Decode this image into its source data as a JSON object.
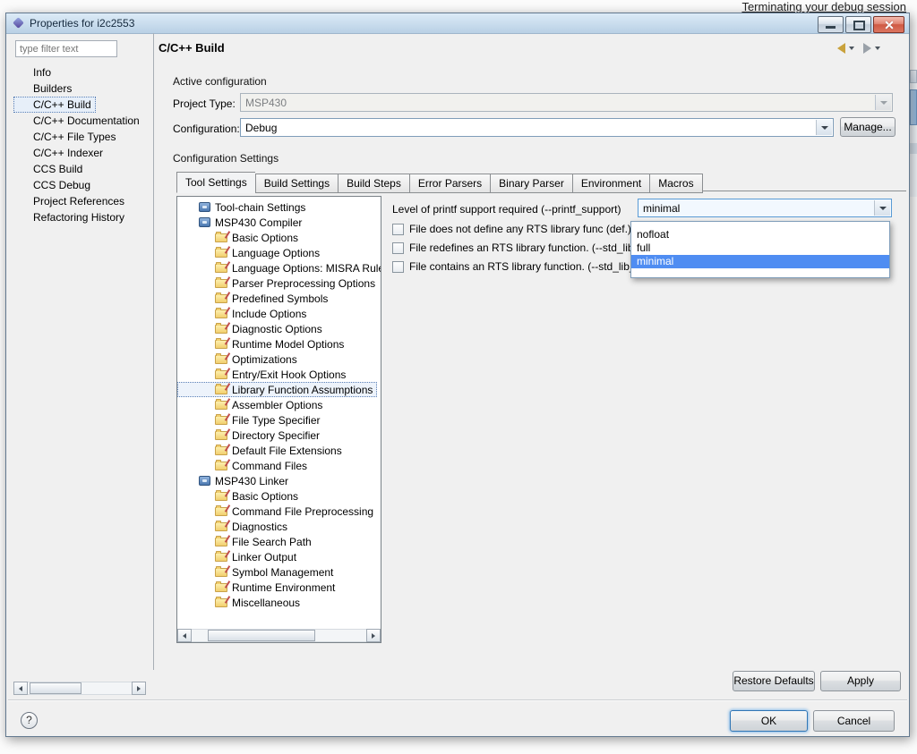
{
  "background": {
    "notification_text": "Terminating your debug session"
  },
  "window": {
    "title": "Properties for i2c2553"
  },
  "filter": {
    "placeholder": "type filter text"
  },
  "sidebar": {
    "items": [
      {
        "label": "Info"
      },
      {
        "label": "Builders"
      },
      {
        "label": "C/C++ Build",
        "selected": true
      },
      {
        "label": "C/C++ Documentation"
      },
      {
        "label": "C/C++ File Types"
      },
      {
        "label": "C/C++ Indexer"
      },
      {
        "label": "CCS Build"
      },
      {
        "label": "CCS Debug"
      },
      {
        "label": "Project References"
      },
      {
        "label": "Refactoring History"
      }
    ]
  },
  "header": {
    "title": "C/C++ Build"
  },
  "active_configuration": {
    "section_label": "Active configuration",
    "project_type_label": "Project Type:",
    "project_type_value": "MSP430",
    "configuration_label": "Configuration:",
    "configuration_value": "Debug",
    "manage_button": "Manage..."
  },
  "configuration_settings": {
    "section_label": "Configuration Settings",
    "tabs": [
      {
        "label": "Tool Settings",
        "active": true
      },
      {
        "label": "Build Settings"
      },
      {
        "label": "Build Steps"
      },
      {
        "label": "Error Parsers"
      },
      {
        "label": "Binary Parser"
      },
      {
        "label": "Environment"
      },
      {
        "label": "Macros"
      }
    ]
  },
  "tool_tree": {
    "items": [
      {
        "label": "Tool-chain Settings",
        "level": 1,
        "icon": "toolchain"
      },
      {
        "label": "MSP430 Compiler",
        "level": 1,
        "icon": "toolchain"
      },
      {
        "label": "Basic Options",
        "level": 2,
        "icon": "folder"
      },
      {
        "label": "Language Options",
        "level": 2,
        "icon": "folder"
      },
      {
        "label": "Language Options: MISRA Rules",
        "level": 2,
        "icon": "folder"
      },
      {
        "label": "Parser Preprocessing Options",
        "level": 2,
        "icon": "folder"
      },
      {
        "label": "Predefined Symbols",
        "level": 2,
        "icon": "folder"
      },
      {
        "label": "Include Options",
        "level": 2,
        "icon": "folder"
      },
      {
        "label": "Diagnostic Options",
        "level": 2,
        "icon": "folder"
      },
      {
        "label": "Runtime Model Options",
        "level": 2,
        "icon": "folder"
      },
      {
        "label": "Optimizations",
        "level": 2,
        "icon": "folder"
      },
      {
        "label": "Entry/Exit Hook Options",
        "level": 2,
        "icon": "folder"
      },
      {
        "label": "Library Function Assumptions",
        "level": 2,
        "icon": "folder",
        "selected": true
      },
      {
        "label": "Assembler Options",
        "level": 2,
        "icon": "folder"
      },
      {
        "label": "File Type Specifier",
        "level": 2,
        "icon": "folder"
      },
      {
        "label": "Directory Specifier",
        "level": 2,
        "icon": "folder"
      },
      {
        "label": "Default File Extensions",
        "level": 2,
        "icon": "folder"
      },
      {
        "label": "Command Files",
        "level": 2,
        "icon": "folder"
      },
      {
        "label": "MSP430 Linker",
        "level": 1,
        "icon": "toolchain"
      },
      {
        "label": "Basic Options",
        "level": 2,
        "icon": "folder"
      },
      {
        "label": "Command File Preprocessing",
        "level": 2,
        "icon": "folder"
      },
      {
        "label": "Diagnostics",
        "level": 2,
        "icon": "folder"
      },
      {
        "label": "File Search Path",
        "level": 2,
        "icon": "folder"
      },
      {
        "label": "Linker Output",
        "level": 2,
        "icon": "folder"
      },
      {
        "label": "Symbol Management",
        "level": 2,
        "icon": "folder"
      },
      {
        "label": "Runtime Environment",
        "level": 2,
        "icon": "folder"
      },
      {
        "label": "Miscellaneous",
        "level": 2,
        "icon": "folder"
      }
    ]
  },
  "settings_pane": {
    "printf_label": "Level of printf support required (--printf_support)",
    "printf_value": "minimal",
    "dropdown_options": [
      {
        "label": "nofloat"
      },
      {
        "label": "full"
      },
      {
        "label": "minimal",
        "selected": true
      }
    ],
    "checkboxes": [
      {
        "label": "File does not define any RTS library func (def.) (-"
      },
      {
        "label": "File redefines an RTS library function. (--std_lib_"
      },
      {
        "label": "File contains an RTS library function. (--std_lib_f"
      }
    ]
  },
  "footer": {
    "restore_defaults": "Restore Defaults",
    "apply": "Apply",
    "ok": "OK",
    "cancel": "Cancel",
    "help": "?"
  }
}
